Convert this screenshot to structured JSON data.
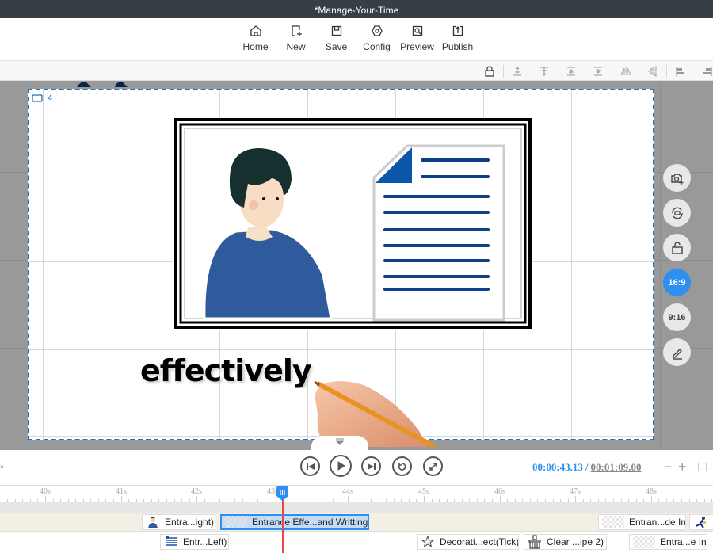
{
  "window": {
    "title": "*Manage-Your-Time"
  },
  "toolbar": {
    "items": [
      {
        "label": "Home",
        "icon": "home-icon"
      },
      {
        "label": "New",
        "icon": "new-file-icon"
      },
      {
        "label": "Save",
        "icon": "save-icon"
      },
      {
        "label": "Config",
        "icon": "config-icon"
      },
      {
        "label": "Preview",
        "icon": "preview-icon"
      },
      {
        "label": "Publish",
        "icon": "publish-icon"
      }
    ]
  },
  "align_toolbar": {
    "icons": [
      "lock-icon",
      "align-top-icon",
      "align-bottom-icon",
      "align-middle-top-icon",
      "align-middle-bottom-icon",
      "flip-horizontal-icon",
      "flip-vertical-icon",
      "align-left-icon",
      "align-right-icon"
    ]
  },
  "canvas": {
    "scene_number": "4",
    "text_element": "effectively",
    "accent_color": "#1f6fc4"
  },
  "side_tools": {
    "items": [
      {
        "name": "snapshot",
        "icon": "camera-add-icon"
      },
      {
        "name": "replace",
        "icon": "replace-icon"
      },
      {
        "name": "unlock",
        "icon": "unlock-icon"
      },
      {
        "name": "ratio-16-9",
        "label": "16:9",
        "active": true
      },
      {
        "name": "ratio-9-16",
        "label": "9:16",
        "active": false
      },
      {
        "name": "edit",
        "icon": "pencil-icon"
      }
    ]
  },
  "playback": {
    "current_time": "00:00:43.13",
    "separator": "/",
    "total_time": "00:01:09.00",
    "zoom_out": "−",
    "zoom_in": "+",
    "accent_color": "#2e8ff0"
  },
  "ruler": {
    "labels": [
      "40s",
      "41s",
      "42s",
      "43s",
      "44s",
      "45s",
      "46s",
      "47s",
      "48s"
    ]
  },
  "tracks": {
    "row1": [
      {
        "label": "Entra...ight)",
        "thumb": "person"
      },
      {
        "label": "Entrance Effe...and Writting)",
        "thumb": "checker",
        "selected": true
      },
      {
        "label": "Entran...de In)",
        "thumb": "checker"
      },
      {
        "label": "",
        "thumb": "runner"
      }
    ],
    "row2": [
      {
        "label": "Entr...Left)",
        "thumb": "document"
      },
      {
        "label": "Decorati...ect(Tick)",
        "thumb": "star"
      },
      {
        "label": "Clear ...ipe 2)",
        "thumb": "broom"
      },
      {
        "label": "Entra...e In)",
        "thumb": "checker"
      }
    ]
  }
}
